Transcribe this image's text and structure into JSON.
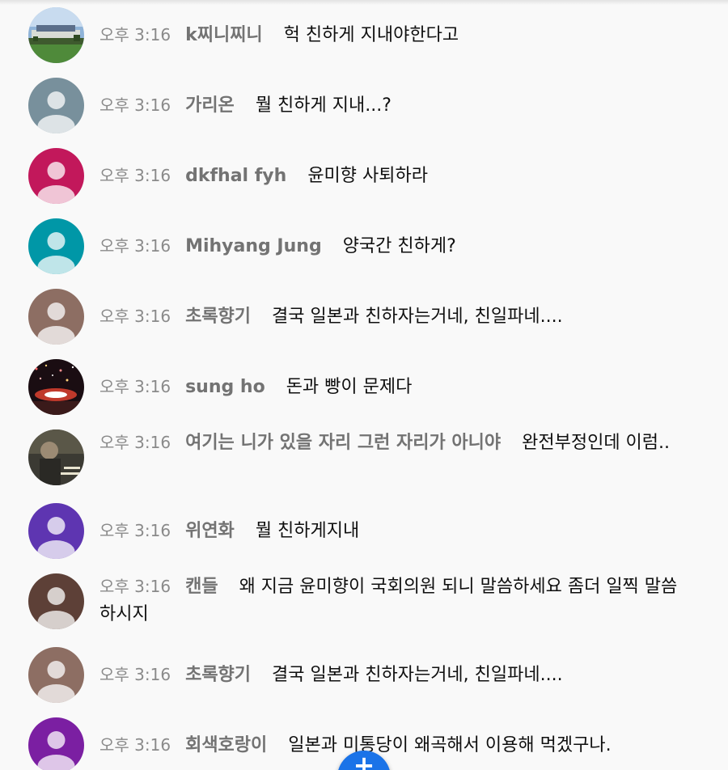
{
  "messages": [
    {
      "time": "오후 3:16",
      "author": "k찌니찌니",
      "text": "헉 친하게 지내야한다고",
      "avatar": {
        "kind": "photo",
        "icon": "landscape-photo"
      }
    },
    {
      "time": "오후 3:16",
      "author": "가리온",
      "text": "뭘 친하게 지내...?",
      "avatar": {
        "kind": "default",
        "color": "#78909c",
        "icon": "person-icon"
      }
    },
    {
      "time": "오후 3:16",
      "author": "dkfhal fyh",
      "text": "윤미향 사퇴하라",
      "avatar": {
        "kind": "default",
        "color": "#c2185b",
        "icon": "person-icon"
      }
    },
    {
      "time": "오후 3:16",
      "author": "Mihyang Jung",
      "text": "양국간 친하게?",
      "avatar": {
        "kind": "default",
        "color": "#0097a7",
        "icon": "person-icon"
      }
    },
    {
      "time": "오후 3:16",
      "author": "초록향기",
      "text": "결국 일본과 친하자는거네, 친일파네....",
      "avatar": {
        "kind": "default",
        "color": "#8d6e63",
        "icon": "person-icon"
      }
    },
    {
      "time": "오후 3:16",
      "author": "sung ho",
      "text": "돈과 빵이 문제다",
      "avatar": {
        "kind": "photo",
        "icon": "stage-lights-photo"
      }
    },
    {
      "time": "오후 3:16",
      "author": "여기는 니가 있을 자리 그런 자리가 아니야",
      "text": "완전부정인데 이럼..",
      "avatar": {
        "kind": "photo",
        "icon": "movie-still-photo"
      }
    },
    {
      "time": "오후 3:16",
      "author": "위연화",
      "text": "뭘 친하게지내",
      "avatar": {
        "kind": "default",
        "color": "#5e35b1",
        "icon": "person-icon"
      }
    },
    {
      "time": "오후 3:16",
      "author": "캔들",
      "text": "왜 지금 윤미향이 국회의원 되니 말씀하세요 좀더 일찍 말씀하시지",
      "avatar": {
        "kind": "default",
        "color": "#5d4037",
        "icon": "person-icon"
      }
    },
    {
      "time": "오후 3:16",
      "author": "초록향기",
      "text": "결국 일본과 친하자는거네, 친일파네....",
      "avatar": {
        "kind": "default",
        "color": "#8d6e63",
        "icon": "person-icon"
      }
    },
    {
      "time": "오후 3:16",
      "author": "회색호랑이",
      "text": "일본과 미통당이 왜곡해서 이용해 먹겠구나.",
      "avatar": {
        "kind": "default",
        "color": "#7b1fa2",
        "icon": "person-icon"
      }
    }
  ],
  "fab": {
    "icon": "plus-icon",
    "color": "#1a73e8"
  }
}
